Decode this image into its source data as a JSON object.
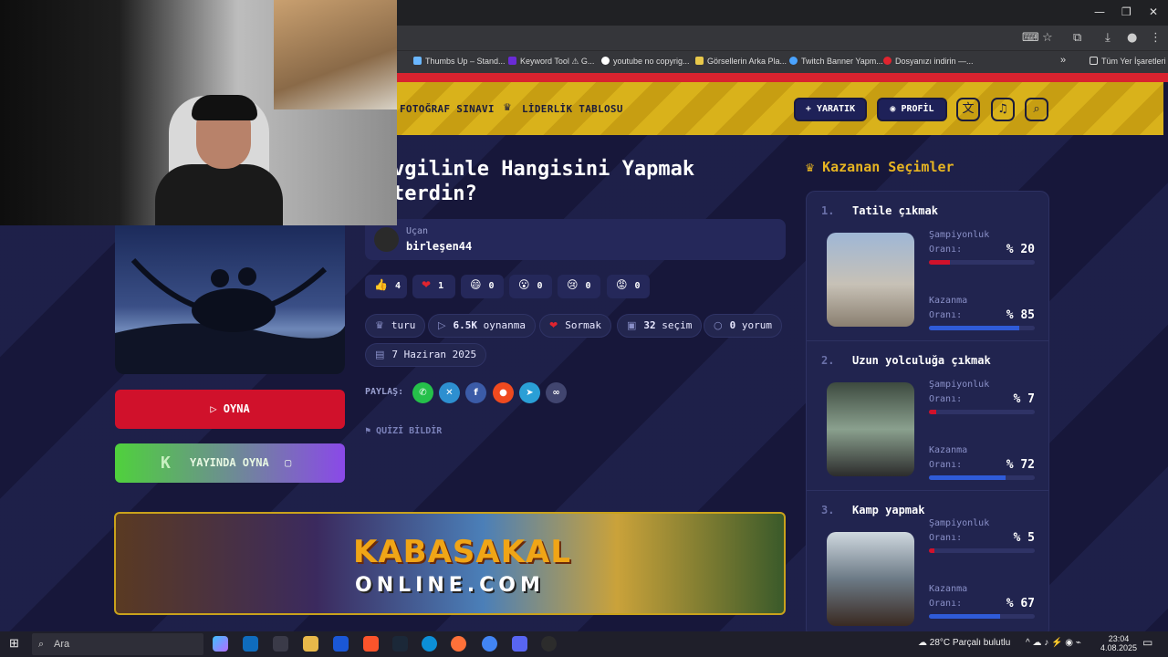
{
  "browser": {
    "bookmarks": [
      {
        "label": "Thumbs Up – Stand...",
        "color": "#6ab7ff"
      },
      {
        "label": "Keyword Tool ⚠ G...",
        "color": "#6a2bd6"
      },
      {
        "label": "youtube no copyrig...",
        "color": "#ffffff"
      },
      {
        "label": "Görsellerin Arka Pla...",
        "color": "#e8c84a"
      },
      {
        "label": "Twitch Banner Yapm...",
        "color": "#4aa3ff"
      },
      {
        "label": "Dosyanızı indirin —...",
        "color": "#e0242f"
      }
    ],
    "more_bookmarks": "»",
    "all_bookmarks": "Tüm Yer İşaretleri"
  },
  "header": {
    "nav": [
      {
        "label": "FOTOĞRAF SINAVI"
      },
      {
        "label": "LİDERLİK TABLOSU"
      }
    ],
    "create_label": "+ YARATIK",
    "profile_label": "PROFİL"
  },
  "quiz": {
    "title_line1": "vgilinle Hangisini Yapmak",
    "title_line2": "terdin?",
    "author_role": "Uçan",
    "author_name": "birleşen44",
    "reactions": [
      {
        "emoji": "👍",
        "count": "4"
      },
      {
        "emoji": "❤",
        "count": "1"
      },
      {
        "emoji": "😄",
        "count": "0"
      },
      {
        "emoji": "😮",
        "count": "0"
      },
      {
        "emoji": "😢",
        "count": "0"
      },
      {
        "emoji": "😡",
        "count": "0"
      }
    ],
    "meta": {
      "type": "turu",
      "plays_num": "6.5K",
      "plays_label": "oynanma",
      "ask": "Sormak",
      "choices_num": "32",
      "choices_label": "seçim",
      "comments_num": "0",
      "comments_label": "yorum",
      "date": "7 Haziran 2025"
    },
    "share_label": "PAYLAŞ:",
    "report_label": "QUİZİ BİLDİR",
    "play_label": "OYNA",
    "stream_label": "YAYINDA OYNA"
  },
  "banner": {
    "line1": "KABASAKAL",
    "line2": "ONLINE.COM"
  },
  "winners": {
    "title": "Kazanan Seçimler",
    "champ_l1": "Şampiyonluk",
    "champ_l2": "Oranı:",
    "win_l1": "Kazanma",
    "win_l2": "Oranı:",
    "items": [
      {
        "rank": "1.",
        "name": "Tatile çıkmak",
        "champ_pct": "% 20",
        "champ": 0.2,
        "win_pct": "% 85",
        "win": 0.85
      },
      {
        "rank": "2.",
        "name": "Uzun yolculuğa çıkmak",
        "champ_pct": "% 7",
        "champ": 0.07,
        "win_pct": "% 72",
        "win": 0.72
      },
      {
        "rank": "3.",
        "name": "Kamp yapmak",
        "champ_pct": "% 5",
        "champ": 0.05,
        "win_pct": "% 67",
        "win": 0.67
      }
    ]
  },
  "taskbar": {
    "search_placeholder": "Ara",
    "weather": "28°C  Parçalı bulutlu",
    "time": "23:04",
    "date": "4.08.2025"
  },
  "colors": {
    "accent": "#e6b422",
    "red": "#d0112b",
    "blue": "#2f5bd8"
  }
}
